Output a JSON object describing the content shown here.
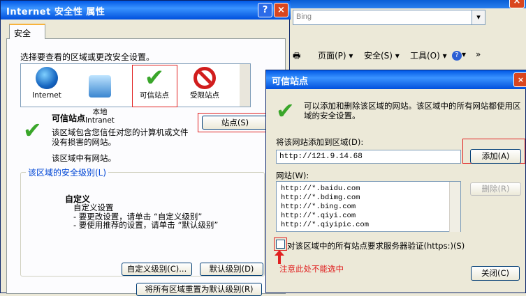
{
  "bg_window": {
    "search_placeholder": "Bing",
    "toolbar": {
      "page_menu": "页面(P) ▾",
      "security_menu": "安全(S) ▾",
      "tools_menu": "工具(O) ▾",
      "help_menu": "▾",
      "more": "»"
    }
  },
  "dialog": {
    "title": "Internet 安全性 属性",
    "help_btn": "?",
    "close_btn": "×",
    "tab": "安全",
    "zone_prompt": "选择要查看的区域或更改安全设置。",
    "zones": [
      {
        "label": "Internet",
        "icon": "globe-icon"
      },
      {
        "label": "本地\nIntranet",
        "icon": "intranet-icon"
      },
      {
        "label": "可信站点",
        "icon": "check-icon"
      },
      {
        "label": "受限站点",
        "icon": "restricted-icon"
      }
    ],
    "selected_zone_title": "可信站点",
    "selected_zone_desc": "该区域包含您信任对您的计算机或文件没有损害的网站。",
    "zone_note": "该区域中有网站。",
    "sites_button": "站点(S)",
    "security_level_legend": "该区域的安全级别(L)",
    "custom_title": "自定义",
    "custom_lines": "自定义设置\n- 要更改设置，请单击 “自定义级别”\n- 要使用推荐的设置，请单击 “默认级别”",
    "custom_level_btn": "自定义级别(C)...",
    "default_level_btn": "默认级别(D)",
    "reset_all_btn": "将所有区域重置为默认级别(R)"
  },
  "trusted_dialog": {
    "title": "可信站点",
    "close_btn": "×",
    "intro": "可以添加和删除该区域的网站。该区域中的所有网站都使用区域的安全设置。",
    "add_label": "将该网站添加到区域(D):",
    "url_value": "http://121.9.14.68",
    "add_btn": "添加(A)",
    "sites_label": "网站(W):",
    "sites": [
      "http://*.baidu.com",
      "http://*.bdimg.com",
      "http://*.bing.com",
      "http://*.qiyi.com",
      "http://*.qiyipic.com"
    ],
    "remove_btn": "删除(R)",
    "https_label": "对该区域中的所有站点要求服务器验证(https:)(S)",
    "https_checked": false,
    "note": "注意此处不能选中",
    "close_ts_btn": "关闭(C)"
  },
  "colors": {
    "title_blue": "#0058e6",
    "highlight_red": "#e02020",
    "dialog_bg": "#ECE9D8"
  }
}
